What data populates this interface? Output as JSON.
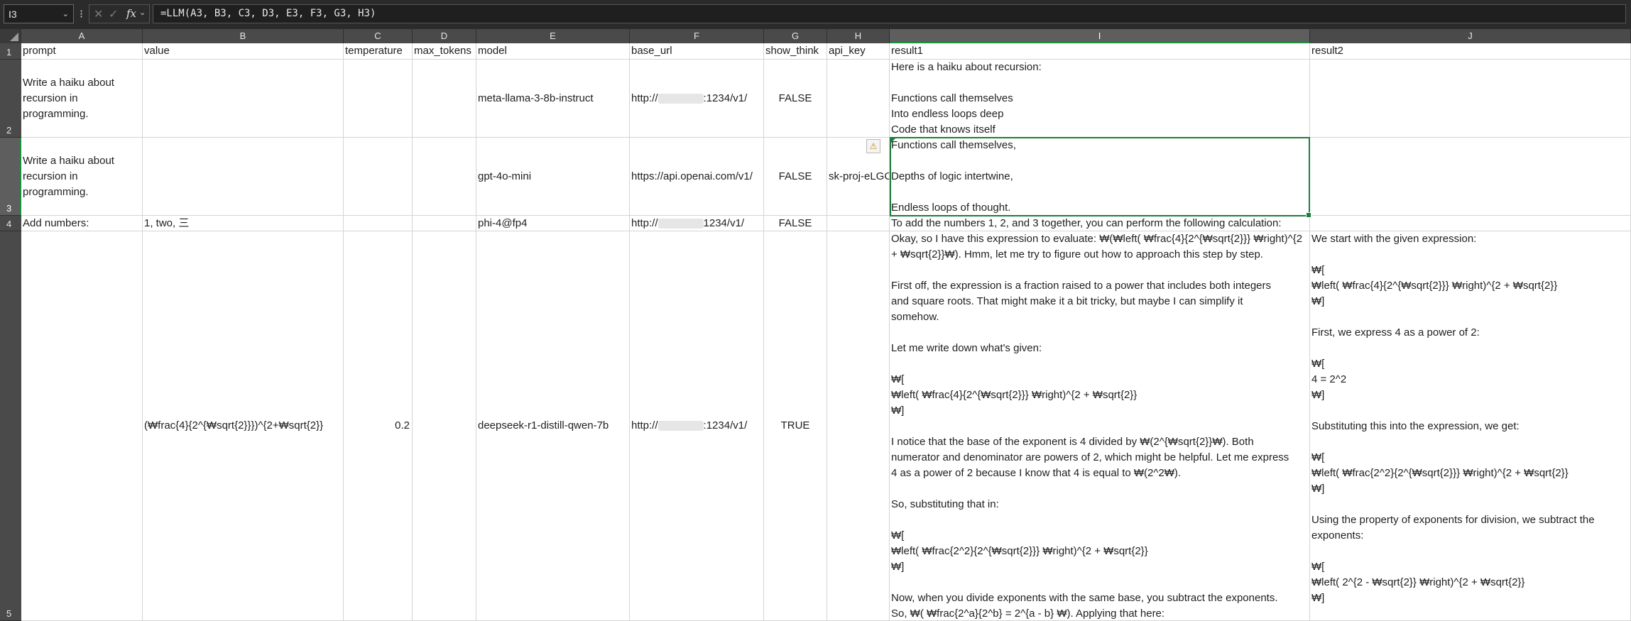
{
  "formula_bar": {
    "name_box": "I3",
    "formula": "=LLM(A3, B3, C3, D3, E3, F3, G3, H3)"
  },
  "columns": [
    "A",
    "B",
    "C",
    "D",
    "E",
    "F",
    "G",
    "H",
    "I",
    "J"
  ],
  "rows": [
    "1",
    "2",
    "3",
    "4",
    "5"
  ],
  "header_row": {
    "A": "prompt",
    "B": "value",
    "C": "temperature",
    "D": "max_tokens",
    "E": "model",
    "F": "base_url",
    "G": "show_think",
    "H": "api_key",
    "I": "result1",
    "J": "result2"
  },
  "row2": {
    "A": "Write a haiku about\nrecursion in\nprogramming.",
    "E": "meta-llama-3-8b-instruct",
    "F_prefix": "http://",
    "F_suffix": ":1234/v1/",
    "G": "FALSE",
    "I": "Here is a haiku about recursion:\n\nFunctions call themselves\nInto endless loops deep\nCode that knows itself"
  },
  "row3": {
    "A": "Write a haiku about\nrecursion in\nprogramming.",
    "E": "gpt-4o-mini",
    "F": "https://api.openai.com/v1/",
    "G": "FALSE",
    "H": "sk-proj-eLGC",
    "I": "Functions call themselves,\n\nDepths of logic intertwine,\n\nEndless loops of thought."
  },
  "row4": {
    "A": "Add numbers:",
    "B": "1, two, 三",
    "E": "phi-4@fp4",
    "F_prefix": "http://",
    "F_suffix": "1234/v1/",
    "G": "FALSE",
    "I": "To add the numbers 1, 2, and 3 together, you can perform the following calculation:"
  },
  "row5": {
    "B": "(₩frac{4}{2^{₩sqrt{2}}})^{2+₩sqrt{2}}",
    "C": "0.2",
    "E": "deepseek-r1-distill-qwen-7b",
    "F_prefix": "http://",
    "F_suffix": ":1234/v1/",
    "G": "TRUE",
    "I": "Okay, so I have this expression to evaluate: ₩(₩left( ₩frac{4}{2^{₩sqrt{2}}} ₩right)^{2\n+ ₩sqrt{2}}₩). Hmm, let me try to figure out how to approach this step by step.\n\nFirst off, the expression is a fraction raised to a power that includes both integers\nand square roots. That might make it a bit tricky, but maybe I can simplify it\nsomehow.\n\nLet me write down what's given:\n\n₩[\n₩left( ₩frac{4}{2^{₩sqrt{2}}} ₩right)^{2 + ₩sqrt{2}}\n₩]\n\nI notice that the base of the exponent is 4 divided by ₩(2^{₩sqrt{2}}₩). Both\nnumerator and denominator are powers of 2, which might be helpful. Let me express\n4 as a power of 2 because I know that 4 is equal to ₩(2^2₩).\n\nSo, substituting that in:\n\n₩[\n₩left( ₩frac{2^2}{2^{₩sqrt{2}}} ₩right)^{2 + ₩sqrt{2}}\n₩]\n\nNow, when you divide exponents with the same base, you subtract the exponents.\nSo, ₩( ₩frac{2^a}{2^b} = 2^{a - b} ₩). Applying that here:",
    "J": "We start with the given expression:\n\n₩[\n₩left( ₩frac{4}{2^{₩sqrt{2}}} ₩right)^{2 + ₩sqrt{2}}\n₩]\n\nFirst, we express 4 as a power of 2:\n\n₩[\n4 = 2^2\n₩]\n\nSubstituting this into the expression, we get:\n\n₩[\n₩left( ₩frac{2^2}{2^{₩sqrt{2}}} ₩right)^{2 + ₩sqrt{2}}\n₩]\n\nUsing the property of exponents for division, we subtract the\nexponents:\n\n₩[\n₩left( 2^{2 - ₩sqrt{2}} ₩right)^{2 + ₩sqrt{2}}\n₩]"
  },
  "colors": {
    "selection": "#1e7c3c",
    "header_bg": "#4a4a4a",
    "toolbar_bg": "#2b2b2b",
    "gridline": "#d4d4d4"
  },
  "icons": {
    "cancel": "✕",
    "enter": "✓",
    "function": "fx",
    "warning": "⚠"
  }
}
